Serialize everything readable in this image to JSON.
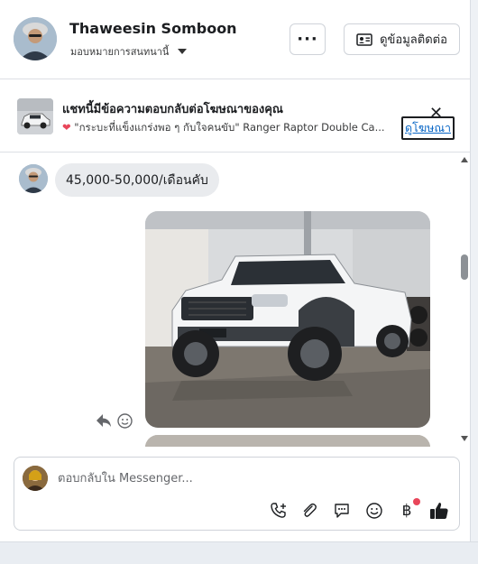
{
  "header": {
    "contact_name": "Thaweesin Somboon",
    "assign_label": "มอบหมายการสนทนานี้",
    "more_label": "···",
    "contact_info_label": "ดูข้อมูลติดต่อ"
  },
  "ad_banner": {
    "title": "แชทนี้มีข้อความตอบกลับต่อโฆษณาของคุณ",
    "subtitle": "\"กระบะที่แข็งแกร่งพอ ๆ กับใจคนขับ\"  Ranger Raptor Double Ca...",
    "view_ad_label": "ดูโฆษณา",
    "close_label": "✕"
  },
  "messages": {
    "incoming_text": "45,000-50,000/เดือนคับ"
  },
  "composer": {
    "placeholder": "ตอบกลับใน Messenger..."
  },
  "colors": {
    "accent": "#0866c6",
    "like": "#1c1e21",
    "notification": "#e8465a",
    "bubble": "#e9ebee"
  },
  "icons": [
    "phone-plus-icon",
    "attachment-icon",
    "saved-reply-icon",
    "emoji-icon",
    "baht-icon",
    "thumbs-up-icon"
  ]
}
